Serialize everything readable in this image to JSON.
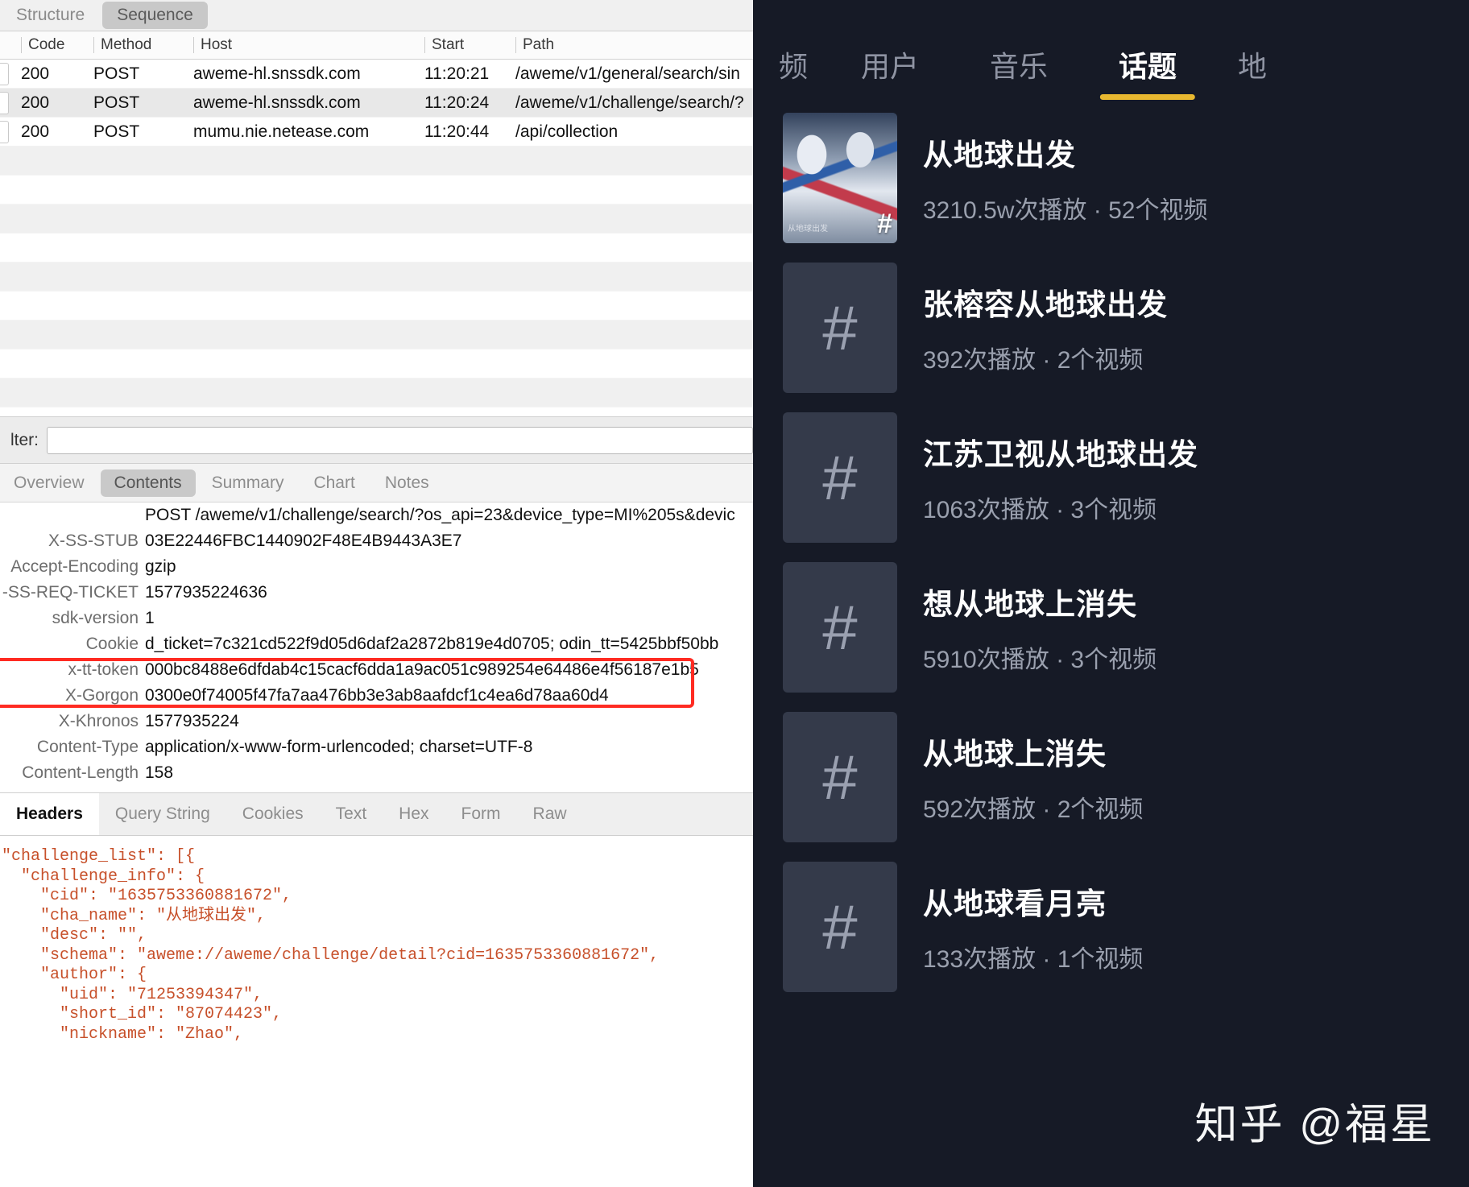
{
  "proxy": {
    "view_toggle": [
      {
        "label": "Structure",
        "active": false
      },
      {
        "label": "Sequence",
        "active": true
      }
    ],
    "table": {
      "columns": [
        "Code",
        "Method",
        "Host",
        "Start",
        "Path"
      ],
      "rows": [
        {
          "code": "200",
          "method": "POST",
          "host": "aweme-hl.snssdk.com",
          "start": "11:20:21",
          "path": "/aweme/v1/general/search/sin",
          "selected": false
        },
        {
          "code": "200",
          "method": "POST",
          "host": "aweme-hl.snssdk.com",
          "start": "11:20:24",
          "path": "/aweme/v1/challenge/search/?",
          "selected": true
        },
        {
          "code": "200",
          "method": "POST",
          "host": "mumu.nie.netease.com",
          "start": "11:20:44",
          "path": "/api/collection",
          "selected": false
        }
      ]
    },
    "filter": {
      "label": "lter:",
      "value": "",
      "placeholder": ""
    },
    "detail_tabs": [
      {
        "label": "Overview",
        "active": false
      },
      {
        "label": "Contents",
        "active": true
      },
      {
        "label": "Summary",
        "active": false
      },
      {
        "label": "Chart",
        "active": false
      },
      {
        "label": "Notes",
        "active": false
      }
    ],
    "request_line": "POST /aweme/v1/challenge/search/?os_api=23&device_type=MI%205s&devic",
    "headers": [
      {
        "key": "X-SS-STUB",
        "value": "03E22446FBC1440902F48E4B9443A3E7",
        "highlight": false
      },
      {
        "key": "Accept-Encoding",
        "value": "gzip",
        "highlight": false
      },
      {
        "key": "-SS-REQ-TICKET",
        "value": "1577935224636",
        "highlight": false
      },
      {
        "key": "sdk-version",
        "value": "1",
        "highlight": false
      },
      {
        "key": "Cookie",
        "value": "d_ticket=7c321cd522f9d05d6daf2a2872b819e4d0705; odin_tt=5425bbf50bb",
        "highlight": false
      },
      {
        "key": "x-tt-token",
        "value": "000bc8488e6dfdab4c15cacf6dda1a9ac051c989254e64486e4f56187e1b5",
        "highlight": true
      },
      {
        "key": "X-Gorgon",
        "value": "0300e0f74005f47fa7aa476bb3e3ab8aafdcf1c4ea6d78aa60d4",
        "highlight": true
      },
      {
        "key": "X-Khronos",
        "value": "1577935224",
        "highlight": false
      },
      {
        "key": "Content-Type",
        "value": "application/x-www-form-urlencoded; charset=UTF-8",
        "highlight": false
      },
      {
        "key": "Content-Length",
        "value": "158",
        "highlight": false
      }
    ],
    "body_tabs": [
      {
        "label": "Headers",
        "active": true
      },
      {
        "label": "Query String",
        "active": false
      },
      {
        "label": "Cookies",
        "active": false
      },
      {
        "label": "Text",
        "active": false
      },
      {
        "label": "Hex",
        "active": false
      },
      {
        "label": "Form",
        "active": false
      },
      {
        "label": "Raw",
        "active": false
      }
    ],
    "json_body": [
      "\"challenge_list\": [{",
      "  \"challenge_info\": {",
      "    \"cid\": \"1635753360881672\",",
      "    \"cha_name\": \"从地球出发\",",
      "    \"desc\": \"\",",
      "    \"schema\": \"aweme://aweme/challenge/detail?cid=1635753360881672\",",
      "    \"author\": {",
      "      \"uid\": \"71253394347\",",
      "      \"short_id\": \"87074423\",",
      "      \"nickname\": \"Zhao\","
    ]
  },
  "app": {
    "accent_color": "#e8b830",
    "tabs": [
      {
        "label": "频",
        "active": false
      },
      {
        "label": "用户",
        "active": false
      },
      {
        "label": "音乐",
        "active": false
      },
      {
        "label": "话题",
        "active": true
      },
      {
        "label": "地",
        "active": false
      }
    ],
    "topics": [
      {
        "title": "从地球出发",
        "stats": "3210.5w次播放 · 52个视频",
        "thumb": "photo",
        "thumb_caption": "从地球出发"
      },
      {
        "title": "张榕容从地球出发",
        "stats": "392次播放 · 2个视频",
        "thumb": "hash"
      },
      {
        "title": "江苏卫视从地球出发",
        "stats": "1063次播放 · 3个视频",
        "thumb": "hash"
      },
      {
        "title": "想从地球上消失",
        "stats": "5910次播放 · 3个视频",
        "thumb": "hash"
      },
      {
        "title": "从地球上消失",
        "stats": "592次播放 · 2个视频",
        "thumb": "hash"
      },
      {
        "title": "从地球看月亮",
        "stats": "133次播放 · 1个视频",
        "thumb": "hash"
      }
    ],
    "watermark": "知乎 @福星"
  }
}
